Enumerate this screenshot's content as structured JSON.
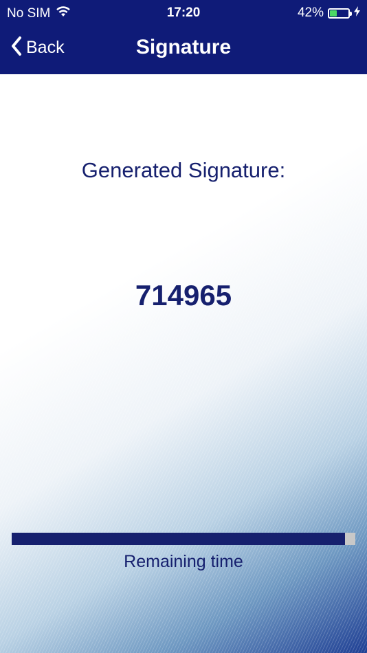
{
  "status_bar": {
    "carrier": "No SIM",
    "time": "17:20",
    "battery_percent": "42%",
    "battery_level": 0.42,
    "battery_color": "#4cd964"
  },
  "nav": {
    "back_label": "Back",
    "title": "Signature"
  },
  "main": {
    "heading": "Generated Signature:",
    "signature_code": "714965",
    "remaining_label": "Remaining time",
    "remaining_fraction": 0.97
  },
  "colors": {
    "header_bg": "#0f1b78",
    "text_primary": "#16206e",
    "progress_track": "#c8c8c8"
  },
  "icons": {
    "wifi": "wifi-icon",
    "back": "chevron-left-icon",
    "charging": "bolt-icon"
  }
}
